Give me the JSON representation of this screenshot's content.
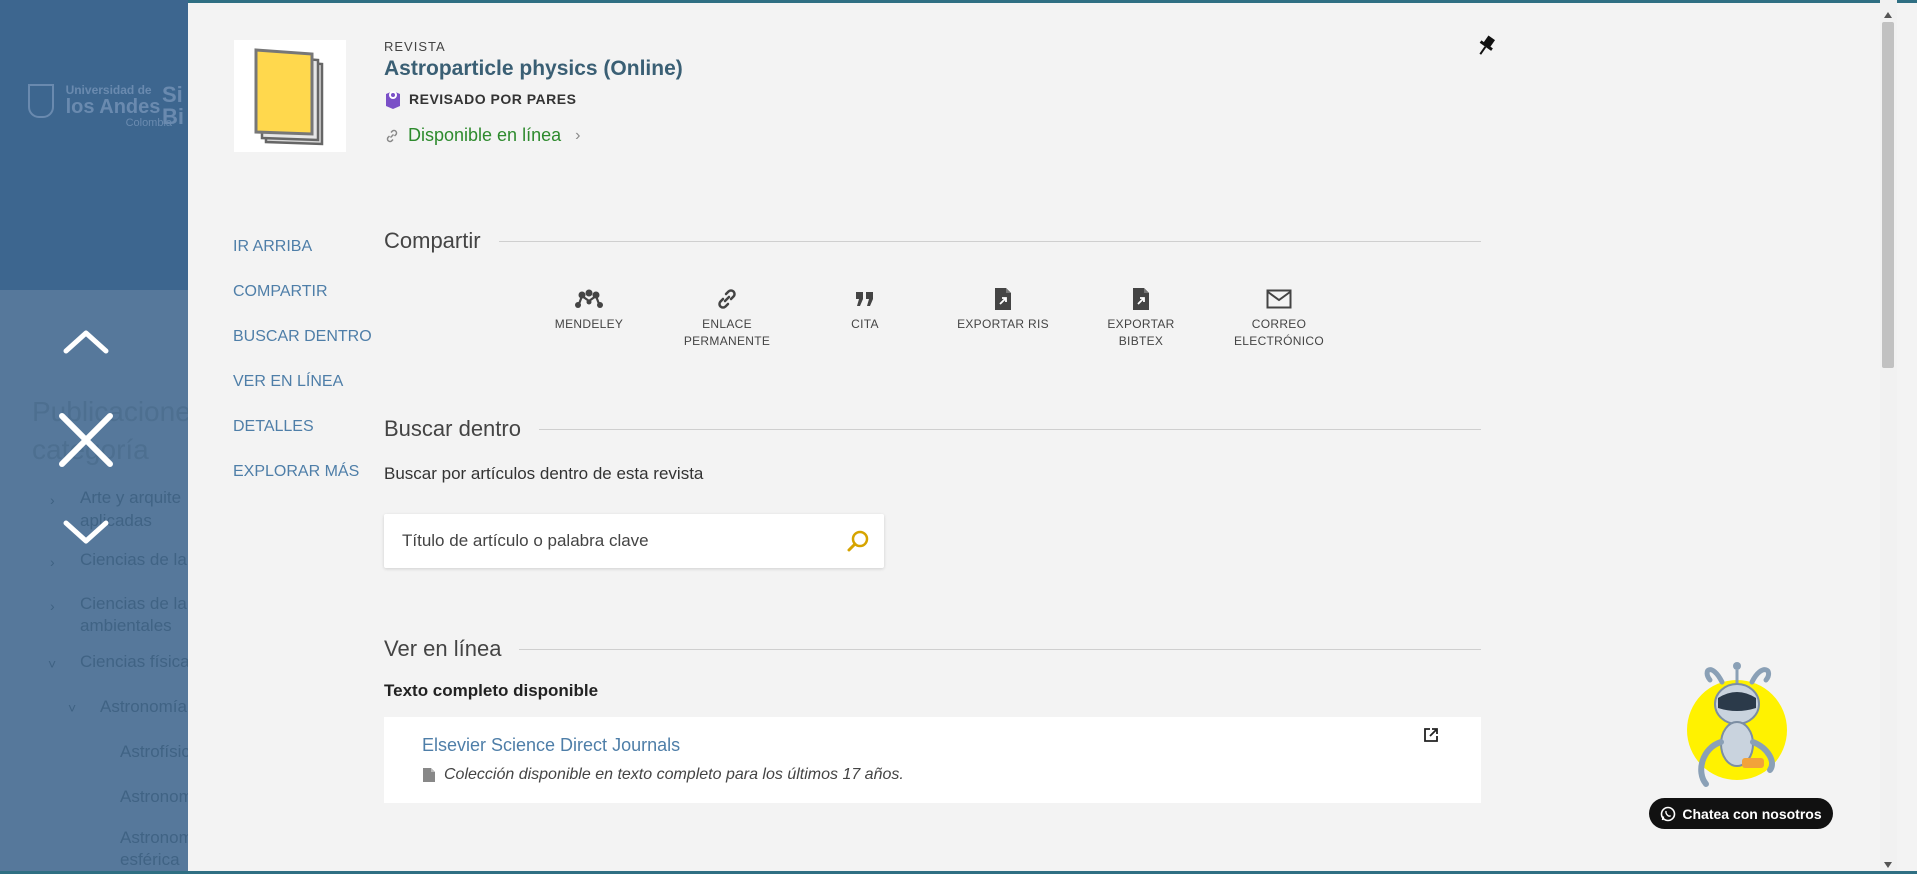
{
  "background": {
    "logo_line1": "Universidad de",
    "logo_line2": "los Andes",
    "logo_line3": "Colombia",
    "logo_side": "Si",
    "logo_side2": "Bi",
    "title_line1": "Publicaciones",
    "title_line2": "categoría",
    "items": [
      "Arte y arquite",
      "aplicadas",
      "Ciencias de la",
      "Ciencias de la",
      "ambientales",
      "Ciencias físicas",
      "Astronomía",
      "Astrofísica",
      "Astronomía",
      "Astronomía",
      "esférica"
    ]
  },
  "nav_controls": {
    "up": "chevron-up-icon",
    "close": "close-icon",
    "down": "chevron-down-icon"
  },
  "record": {
    "type": "REVISTA",
    "title": "Astroparticle physics (Online)",
    "peer_reviewed": "REVISADO POR PARES",
    "availability": "Disponible en línea"
  },
  "section_nav": [
    "IR ARRIBA",
    "COMPARTIR",
    "BUSCAR DENTRO",
    "VER EN LÍNEA",
    "DETALLES",
    "EXPLORAR MÁS"
  ],
  "share": {
    "heading": "Compartir",
    "actions": [
      {
        "line1": "MENDELEY",
        "line2": "",
        "icon": "mendeley-icon"
      },
      {
        "line1": "ENLACE",
        "line2": "PERMANENTE",
        "icon": "link-icon"
      },
      {
        "line1": "CITA",
        "line2": "",
        "icon": "quote-icon"
      },
      {
        "line1": "EXPORTAR RIS",
        "line2": "",
        "icon": "export-file-icon"
      },
      {
        "line1": "EXPORTAR",
        "line2": "BIBTEX",
        "icon": "export-file-icon"
      },
      {
        "line1": "CORREO",
        "line2": "ELECTRÓNICO",
        "icon": "mail-icon"
      }
    ]
  },
  "search_within": {
    "heading": "Buscar dentro",
    "description": "Buscar por artículos dentro de esta revista",
    "placeholder": "Título de artículo o palabra clave"
  },
  "view_online": {
    "heading": "Ver en línea",
    "fulltext_label": "Texto completo disponible",
    "provider": "Elsevier Science Direct Journals",
    "coverage": "Colección disponible en texto completo para los últimos 17 años."
  },
  "chat": {
    "label": "Chatea con nosotros"
  },
  "colors": {
    "link_blue": "#4e7ea8",
    "available_green": "#2d8a2d",
    "title_teal": "#3a5f74",
    "peer_purple": "#7a4fc7",
    "search_yellow": "#d6a400"
  }
}
